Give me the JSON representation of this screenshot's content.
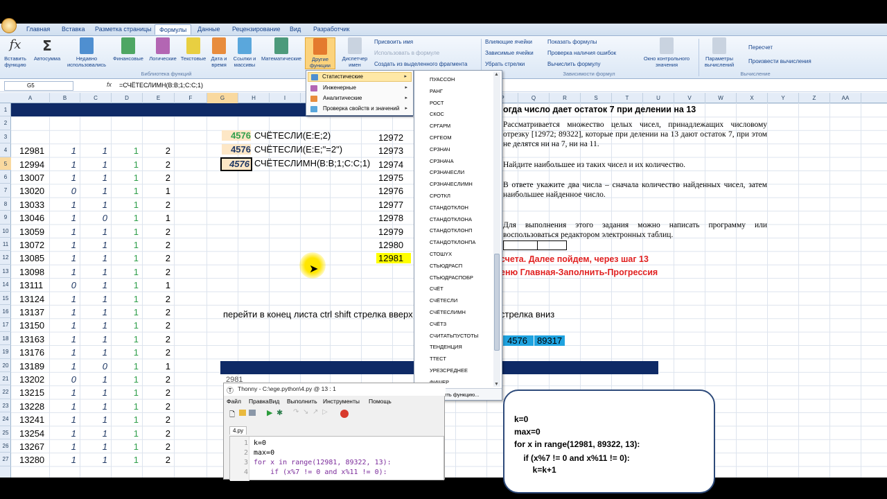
{
  "ribbon": {
    "tabs": [
      "Главная",
      "Вставка",
      "Разметка страницы",
      "Формулы",
      "Данные",
      "Рецензирование",
      "Вид",
      "Разработчик"
    ],
    "buttons": {
      "insert_fn": "Вставить функцию",
      "autosum": "Автосумма",
      "recent": "Недавно использовались",
      "financial": "Финансовые",
      "logical": "Логические",
      "text": "Текстовые",
      "datetime": "Дата и время",
      "lookup": "Ссылки и массивы",
      "math": "Математические",
      "other": "Другие функции",
      "name_mgr": "Диспетчер имен",
      "assign_name": "Присвоить имя",
      "use_in_formula": "Использовать в формуле",
      "create_from_sel": "Создать из выделенного фрагмента",
      "trace_precedents": "Влияющие ячейки",
      "trace_dependents": "Зависимые ячейки",
      "remove_arrows": "Убрать стрелки",
      "show_formulas": "Показать формулы",
      "error_check": "Проверка наличия ошибок",
      "evaluate": "Вычислить формулу",
      "watch": "Окно контрольного значения",
      "calc_options": "Параметры вычислений",
      "recalc": "Пересчет",
      "calc_sheet": "Произвести вычисления"
    },
    "groups": {
      "library": "Библиотека функций",
      "dependencies": "Зависимости формул",
      "calculation": "Вычисление"
    }
  },
  "formula_bar": {
    "name_box": "G5",
    "fx": "fx",
    "formula": "=СЧЁТЕСЛИМН(B:B;1;C:C;1)"
  },
  "columns": [
    "A",
    "B",
    "C",
    "D",
    "E",
    "F",
    "G",
    "H",
    "I",
    "J",
    "K",
    "L",
    "M",
    "N",
    "O",
    "P",
    "Q",
    "R",
    "S",
    "T",
    "U",
    "V",
    "W",
    "X",
    "Y",
    "Z",
    "AA"
  ],
  "rows": [
    "1",
    "2",
    "3",
    "4",
    "5",
    "6",
    "7",
    "8",
    "9",
    "10",
    "11",
    "12",
    "13",
    "14",
    "15",
    "16",
    "17",
    "18",
    "19",
    "20",
    "21",
    "22",
    "23",
    "24",
    "25",
    "26",
    "27"
  ],
  "grid": {
    "col_a": [
      "12981",
      "12994",
      "13007",
      "13020",
      "13033",
      "13046",
      "13059",
      "13072",
      "13085",
      "13098",
      "13111",
      "13124",
      "13137",
      "13150",
      "13163",
      "13176",
      "13189",
      "13202",
      "13215",
      "13228",
      "13241",
      "13254",
      "13267",
      "13280"
    ],
    "col_b": [
      "1",
      "1",
      "1",
      "0",
      "1",
      "1",
      "1",
      "1",
      "1",
      "1",
      "0",
      "1",
      "1",
      "1",
      "1",
      "1",
      "1",
      "0",
      "1",
      "1",
      "1",
      "1",
      "1",
      "1"
    ],
    "col_c": [
      "1",
      "1",
      "1",
      "1",
      "1",
      "0",
      "1",
      "1",
      "1",
      "1",
      "1",
      "1",
      "1",
      "1",
      "1",
      "1",
      "0",
      "1",
      "1",
      "1",
      "1",
      "1",
      "1",
      "1"
    ],
    "col_d": [
      "1",
      "1",
      "1",
      "1",
      "1",
      "1",
      "1",
      "1",
      "1",
      "1",
      "1",
      "1",
      "1",
      "1",
      "1",
      "1",
      "1",
      "1",
      "1",
      "1",
      "1",
      "1",
      "1",
      "1"
    ],
    "col_e": [
      "2",
      "2",
      "2",
      "1",
      "2",
      "1",
      "2",
      "2",
      "2",
      "2",
      "1",
      "2",
      "2",
      "2",
      "2",
      "2",
      "1",
      "2",
      "2",
      "2",
      "2",
      "2",
      "2",
      "2"
    ],
    "g3": "4576",
    "h3": "СЧЁТЕСЛИ(E:E;2)",
    "g4": "4576",
    "h4": "СЧЁТЕСЛИ(E:E;\"=2\")",
    "g5": "4576",
    "h5": "СЧЁТЕСЛИМН(B:B;1;C:C;1)",
    "col_j": [
      "12972",
      "12973",
      "12974",
      "12975",
      "12976",
      "12977",
      "12978",
      "12979",
      "12980",
      "12981"
    ],
    "row16": "перейти в конец листа ctrl shift стрелка вверх",
    "row16b": "стрелка вниз",
    "p18": "4576",
    "q18": "89317",
    "row21_partial": "2981",
    "task_title": "огда число дает остаток 7 при делении на 13",
    "task_p1": "Рассматривается множество целых чисел, принадлежащих числовому отрезку [12972; 89322], которые при делении на 13 дают остаток 7, при этом не делятся ни на 7, ни на 11.",
    "task_p2": "Найдите наибольшее из таких чисел и их количество.",
    "task_p3": "В ответе укажите два числа – сначала количество найденных чисел, затем наибольшее найденное число.",
    "task_p4": "Для выполнения этого задания можно написать программу или воспользоваться редактором электронных таблиц.",
    "red1": "счета. Далее пойдем, через шаг 13",
    "red2": "еню Главная-Заполнить-Прогрессия"
  },
  "dropdown": {
    "items": [
      "Статистические",
      "Инженерные",
      "Аналитические",
      "Проверка свойств и значений"
    ]
  },
  "submenu": {
    "items": [
      "ПУАССОН",
      "РАНГ",
      "РОСТ",
      "СКОС",
      "СРГАРМ",
      "СРГЕОМ",
      "СРЗНАЧ",
      "СРЗНАЧА",
      "СРЗНАЧЕСЛИ",
      "СРЗНАЧЕСЛИМН",
      "СРОТКЛ",
      "СТАНДОТКЛОН",
      "СТАНДОТКЛОНА",
      "СТАНДОТКЛОНП",
      "СТАНДОТКЛОНПА",
      "СТОШYX",
      "СТЬЮДРАСП",
      "СТЬЮДРАСПОБР",
      "СЧЁТ",
      "СЧЁТЕСЛИ",
      "СЧЁТЕСЛИМН",
      "СЧЁТЗ",
      "СЧИТАТЬПУСТОТЫ",
      "ТЕНДЕНЦИЯ",
      "ТТЕСТ",
      "УРЕЗСРЕДНЕЕ",
      "ФИШЕР"
    ],
    "insert_fn": "Вставить функцию..."
  },
  "thonny": {
    "title": "Thonny  -  C:\\ege.python\\4.py  @  13 : 1",
    "menu": [
      "Файл",
      "Правка",
      "Вид",
      "Выполнить",
      "Инструменты",
      "Помощь"
    ],
    "tab": "4.py",
    "lines": [
      "k=0",
      "max=0",
      "for x in range(12981, 89322, 13):",
      "    if (x%7 != 0 and x%11 != 0):"
    ],
    "line_numbers": [
      "1",
      "2",
      "3",
      "4"
    ]
  },
  "note": {
    "lines": [
      "k=0",
      "max=0",
      "for x in range(12981, 89322, 13):",
      "    if (x%7 != 0 and x%11 != 0):",
      "        k=k+1"
    ]
  }
}
